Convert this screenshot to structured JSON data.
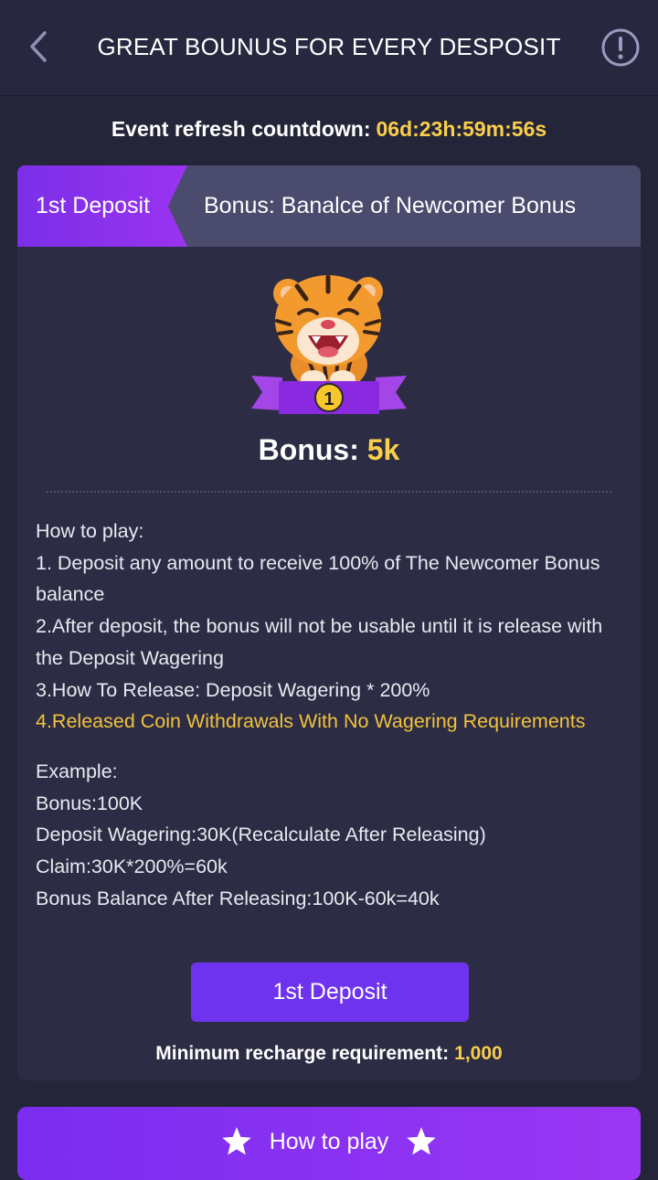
{
  "header": {
    "title": "GREAT BOUNUS FOR EVERY DESPOSIT",
    "back_icon": "chevron-left-icon",
    "info_icon": "exclamation-circle-icon"
  },
  "countdown": {
    "label": "Event refresh countdown:",
    "value": "06d:23h:59m:56s"
  },
  "card": {
    "tab_label": "1st Deposit",
    "tab_description": "Bonus: Banalce of Newcomer Bonus",
    "badge_number": "1",
    "bonus_label": "Bonus:",
    "bonus_amount": "5k",
    "rules": {
      "title": "How to play:",
      "item1": "1. Deposit any amount to receive 100% of The Newcomer Bonus balance",
      "item2": "2.After deposit, the bonus will not be usable until it is release with the Deposit Wagering",
      "item3": "3.How To Release: Deposit Wagering * 200%",
      "item4": "4.Released Coin Withdrawals With No Wagering Requirements"
    },
    "example": {
      "title": "Example:",
      "line1": "Bonus:100K",
      "line2": "Deposit Wagering:30K(Recalculate After Releasing)",
      "line3": "Claim:30K*200%=60k",
      "line4": "Bonus Balance After Releasing:100K-60k=40k"
    },
    "deposit_button": "1st Deposit",
    "min_requirement_label": "Minimum recharge requirement:",
    "min_requirement_value": "1,000"
  },
  "footer": {
    "how_to_play_button": "How to play",
    "star_icon": "star-icon"
  },
  "colors": {
    "background": "#25253a",
    "card": "#2c2c45",
    "accent_purple": "#6d33ee",
    "highlight_gold": "#f9cf4a"
  }
}
